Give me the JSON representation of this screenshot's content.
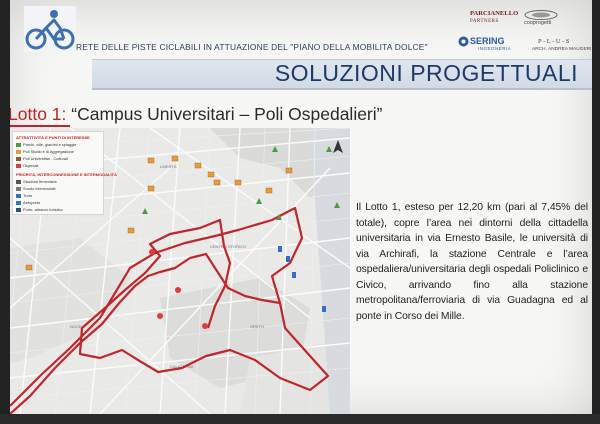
{
  "header": {
    "title": "RETE DELLE PISTE CICLABILI IN ATTUAZIONE DEL \"PIANO DELLA MOBILITA DOLCE\"",
    "partners": {
      "parcianello_line1": "PARCIANELLO",
      "parcianello_line2": "PARTNERS",
      "cooprogetti": "cooprogetti",
      "sering": "SERING",
      "sering_sub": "INGEGNERIA",
      "plus": "P-L-U-S",
      "plus_sub": "ARCH. ANDREA MAUGERI"
    }
  },
  "slide_title": "SOLUZIONI PROGETTUALI",
  "lotto": {
    "label": "Lotto 1:",
    "name": "“Campus Universitari – Poli Ospedalieri”"
  },
  "legend": {
    "heading1": "ATTRATTIVITÀ E PUNTI DI INTERESSE",
    "items1": [
      "Parchi, ville, giardini e spiaggie",
      "Poli Studio e di Aggregazione",
      "Poli Universitari - Culturali",
      "Ospedali"
    ],
    "heading2": "PRIORITÀ, INTERCONNESSIONE E INTERMODALITÀ",
    "items2": [
      "Stazione ferroviaria",
      "Snodo intermodale",
      "Tram",
      "Aeroporto",
      "Porto, attracco turistico"
    ]
  },
  "description": "Il Lotto 1, esteso per 12,20 km (pari al 7,45% del totale), copre l’area nei dintorni della cittadella universitaria in via Ernesto Basile, le università di via Archirafi, la stazione Centrale e l’area ospedaliera/universitaria degli ospedali Policlinico e Civico, arrivando fino alla stazione metropolitana/ferroviaria di via Guadagna ed al ponte in Corso dei Mille.",
  "colors": {
    "route": "#c0262c",
    "title_band": "#d8e0ea",
    "title_text": "#1f3a6a",
    "accent_red": "#c62222"
  }
}
